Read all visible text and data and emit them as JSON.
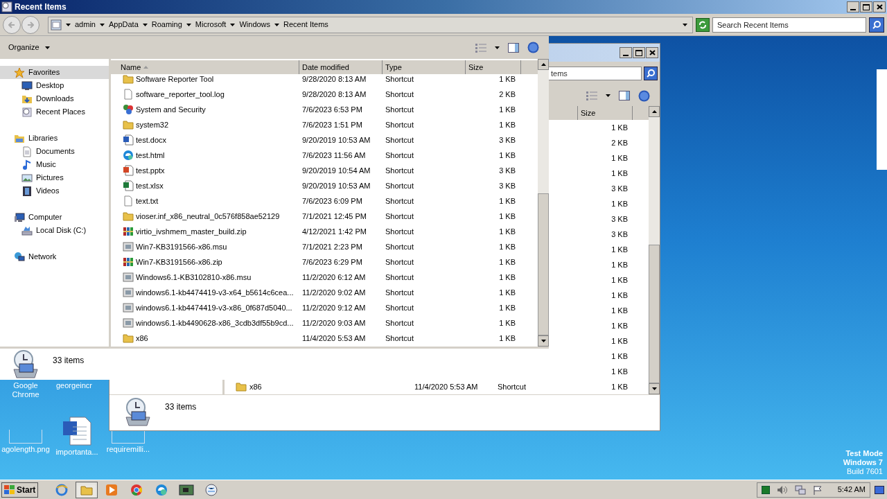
{
  "desktop_icons": [
    {
      "label": "Google\nChrome",
      "kind": "hidden"
    },
    {
      "label": "georgeincr",
      "kind": "hidden"
    },
    {
      "label": "agolength.png",
      "kind": "image"
    },
    {
      "label": "importanta...",
      "kind": "word"
    },
    {
      "label": "requiremilli...",
      "kind": "image"
    }
  ],
  "os_notice": [
    "Test Mode",
    "Windows 7",
    "Build 7601"
  ],
  "back_window": {
    "search": {
      "placeholder": "tems"
    },
    "columns": [
      {
        "label": "Size"
      }
    ],
    "rows": [
      {
        "size": "1 KB"
      },
      {
        "size": "2 KB"
      },
      {
        "size": "1 KB"
      },
      {
        "size": "1 KB"
      },
      {
        "size": "3 KB"
      },
      {
        "size": "1 KB"
      },
      {
        "size": "3 KB"
      },
      {
        "size": "3 KB"
      },
      {
        "size": "1 KB"
      },
      {
        "size": "1 KB"
      },
      {
        "size": "1 KB"
      },
      {
        "size": "1 KB"
      },
      {
        "size": "1 KB"
      },
      {
        "size": "1 KB"
      },
      {
        "size": "1 KB"
      },
      {
        "size": "1 KB"
      },
      {
        "size": "1 KB"
      },
      {
        "name": "x86",
        "kind": "folder",
        "date": "11/4/2020 5:53 AM",
        "type": "Shortcut",
        "size": "1 KB"
      }
    ],
    "status": "33 items"
  },
  "main_window": {
    "title": "Recent Items",
    "breadcrumb": [
      "admin",
      "AppData",
      "Roaming",
      "Microsoft",
      "Windows",
      "Recent Items"
    ],
    "search": {
      "placeholder": "Search Recent Items"
    },
    "toolbar": {
      "organize": "Organize"
    },
    "nav": [
      {
        "label": "Favorites",
        "kind": "star",
        "selected": true,
        "children": [
          {
            "label": "Desktop",
            "kind": "desktop",
            "selected": false
          },
          {
            "label": "Downloads",
            "kind": "downloads",
            "selected": false
          },
          {
            "label": "Recent Places",
            "kind": "recent",
            "selected": false
          }
        ]
      },
      {
        "label": "Libraries",
        "kind": "library",
        "selected": false,
        "children": [
          {
            "label": "Documents",
            "kind": "documents",
            "selected": false
          },
          {
            "label": "Music",
            "kind": "music",
            "selected": false
          },
          {
            "label": "Pictures",
            "kind": "pictures",
            "selected": false
          },
          {
            "label": "Videos",
            "kind": "videos",
            "selected": false
          }
        ]
      },
      {
        "label": "Computer",
        "kind": "computer",
        "selected": false,
        "children": [
          {
            "label": "Local Disk (C:)",
            "kind": "disk",
            "selected": false
          }
        ]
      },
      {
        "label": "Network",
        "kind": "network",
        "selected": false
      }
    ],
    "columns": [
      {
        "label": "Name",
        "sorted": true
      },
      {
        "label": "Date modified",
        "sorted": false
      },
      {
        "label": "Type",
        "sorted": false
      },
      {
        "label": "Size",
        "sorted": false
      }
    ],
    "rows": [
      {
        "name": "Software Reporter Tool",
        "kind": "folder",
        "date": "9/28/2020 8:13 AM",
        "type": "Shortcut",
        "size": "1 KB"
      },
      {
        "name": "software_reporter_tool.log",
        "kind": "text",
        "date": "9/28/2020 8:13 AM",
        "type": "Shortcut",
        "size": "2 KB"
      },
      {
        "name": "System and Security",
        "kind": "control",
        "date": "7/6/2023 6:53 PM",
        "type": "Shortcut",
        "size": "1 KB"
      },
      {
        "name": "system32",
        "kind": "folder",
        "date": "7/6/2023 1:51 PM",
        "type": "Shortcut",
        "size": "1 KB"
      },
      {
        "name": "test.docx",
        "kind": "word",
        "date": "9/20/2019 10:53 AM",
        "type": "Shortcut",
        "size": "3 KB"
      },
      {
        "name": "test.html",
        "kind": "browser",
        "date": "7/6/2023 11:56 AM",
        "type": "Shortcut",
        "size": "1 KB"
      },
      {
        "name": "test.pptx",
        "kind": "slides",
        "date": "9/20/2019 10:54 AM",
        "type": "Shortcut",
        "size": "3 KB"
      },
      {
        "name": "test.xlsx",
        "kind": "sheet",
        "date": "9/20/2019 10:53 AM",
        "type": "Shortcut",
        "size": "3 KB"
      },
      {
        "name": "text.txt",
        "kind": "text",
        "date": "7/6/2023 6:09 PM",
        "type": "Shortcut",
        "size": "1 KB"
      },
      {
        "name": "vioser.inf_x86_neutral_0c576f858ae52129",
        "kind": "folder",
        "date": "7/1/2021 12:45 PM",
        "type": "Shortcut",
        "size": "1 KB"
      },
      {
        "name": "virtio_ivshmem_master_build.zip",
        "kind": "archive",
        "date": "4/12/2021 1:42 PM",
        "type": "Shortcut",
        "size": "1 KB"
      },
      {
        "name": "Win7-KB3191566-x86.msu",
        "kind": "installer",
        "date": "7/1/2021 2:23 PM",
        "type": "Shortcut",
        "size": "1 KB"
      },
      {
        "name": "Win7-KB3191566-x86.zip",
        "kind": "archive",
        "date": "7/6/2023 6:29 PM",
        "type": "Shortcut",
        "size": "1 KB"
      },
      {
        "name": "Windows6.1-KB3102810-x86.msu",
        "kind": "installer",
        "date": "11/2/2020 6:12 AM",
        "type": "Shortcut",
        "size": "1 KB"
      },
      {
        "name": "windows6.1-kb4474419-v3-x64_b5614c6cea...",
        "kind": "installer",
        "date": "11/2/2020 9:02 AM",
        "type": "Shortcut",
        "size": "1 KB"
      },
      {
        "name": "windows6.1-kb4474419-v3-x86_0f687d5040...",
        "kind": "installer",
        "date": "11/2/2020 9:12 AM",
        "type": "Shortcut",
        "size": "1 KB"
      },
      {
        "name": "windows6.1-kb4490628-x86_3cdb3df55b9cd...",
        "kind": "installer",
        "date": "11/2/2020 9:03 AM",
        "type": "Shortcut",
        "size": "1 KB"
      },
      {
        "name": "x86",
        "kind": "folder",
        "date": "11/4/2020 5:53 AM",
        "type": "Shortcut",
        "size": "1 KB"
      }
    ],
    "status": "33 items"
  },
  "taskbar": {
    "start": "Start",
    "apps": [
      {
        "kind": "ie",
        "active": false
      },
      {
        "kind": "explorer",
        "active": true
      },
      {
        "kind": "media",
        "active": false
      },
      {
        "kind": "chrome",
        "active": false
      },
      {
        "kind": "edge",
        "active": false
      },
      {
        "kind": "board",
        "active": false
      },
      {
        "kind": "globe",
        "active": false
      }
    ],
    "clock": "5:42 AM"
  }
}
